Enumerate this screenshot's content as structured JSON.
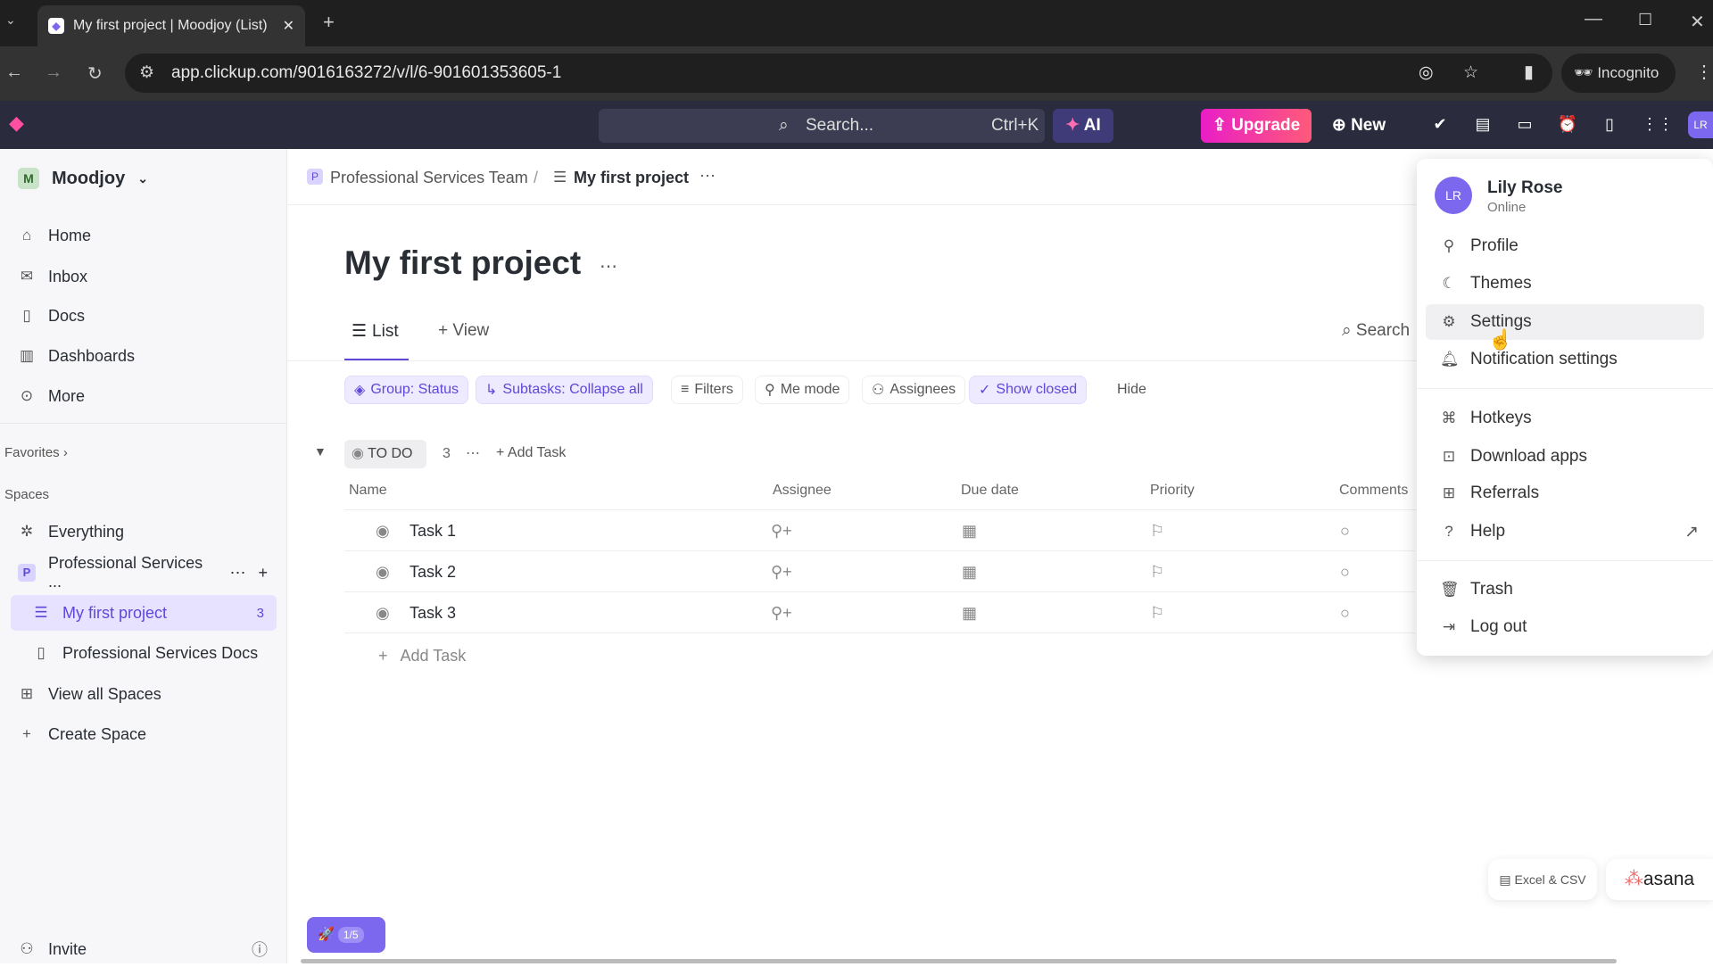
{
  "browser": {
    "tab_title": "My first project | Moodjoy (List)",
    "url": "app.clickup.com/9016163272/v/l/6-901601353605-1",
    "incognito": "Incognito"
  },
  "header": {
    "search_placeholder": "Search...",
    "search_shortcut": "Ctrl+K",
    "ai": "AI",
    "upgrade": "Upgrade",
    "new": "New",
    "avatar": "LR",
    "upgrade_color": "#e91ec6",
    "accent": "#7b68ee"
  },
  "sidebar": {
    "workspace_initial": "M",
    "workspace": "Moodjoy",
    "items": [
      {
        "label": "Home",
        "icon": "home-icon"
      },
      {
        "label": "Inbox",
        "icon": "inbox-icon"
      },
      {
        "label": "Docs",
        "icon": "docs-icon"
      },
      {
        "label": "Dashboards",
        "icon": "dashboard-icon"
      },
      {
        "label": "More",
        "icon": "more-icon"
      }
    ],
    "favorites": "Favorites",
    "spaces": "Spaces",
    "everything": "Everything",
    "space_initial": "P",
    "space": "Professional Services ...",
    "project": "My first project",
    "project_count": "3",
    "space_docs": "Professional Services Docs",
    "view_all": "View all Spaces",
    "create": "Create Space",
    "invite": "Invite"
  },
  "breadcrumb": {
    "space": "Professional Services Team",
    "list": "My first project"
  },
  "page": {
    "title": "My first project",
    "tab_list": "List",
    "tab_view": "View",
    "search": "Search"
  },
  "filters": [
    "Group: Status",
    "Subtasks: Collapse all",
    "Filters",
    "Me mode",
    "Assignees",
    "Show closed",
    "Hide"
  ],
  "group": {
    "status": "TO DO",
    "count": "3",
    "add_task": "Add Task"
  },
  "columns": [
    "Name",
    "Assignee",
    "Due date",
    "Priority",
    "Comments"
  ],
  "tasks": [
    "Task 1",
    "Task 2",
    "Task 3"
  ],
  "add_task": "Add Task",
  "menu": {
    "name": "Lily Rose",
    "status": "Online",
    "avatar": "LR",
    "items": [
      "Profile",
      "Themes",
      "Settings",
      "Notification settings",
      "Hotkeys",
      "Download apps",
      "Referrals",
      "Help",
      "Trash",
      "Log out"
    ]
  },
  "bottom": {
    "progress": "1/5",
    "excel": "Excel & CSV",
    "asana": "asana"
  }
}
